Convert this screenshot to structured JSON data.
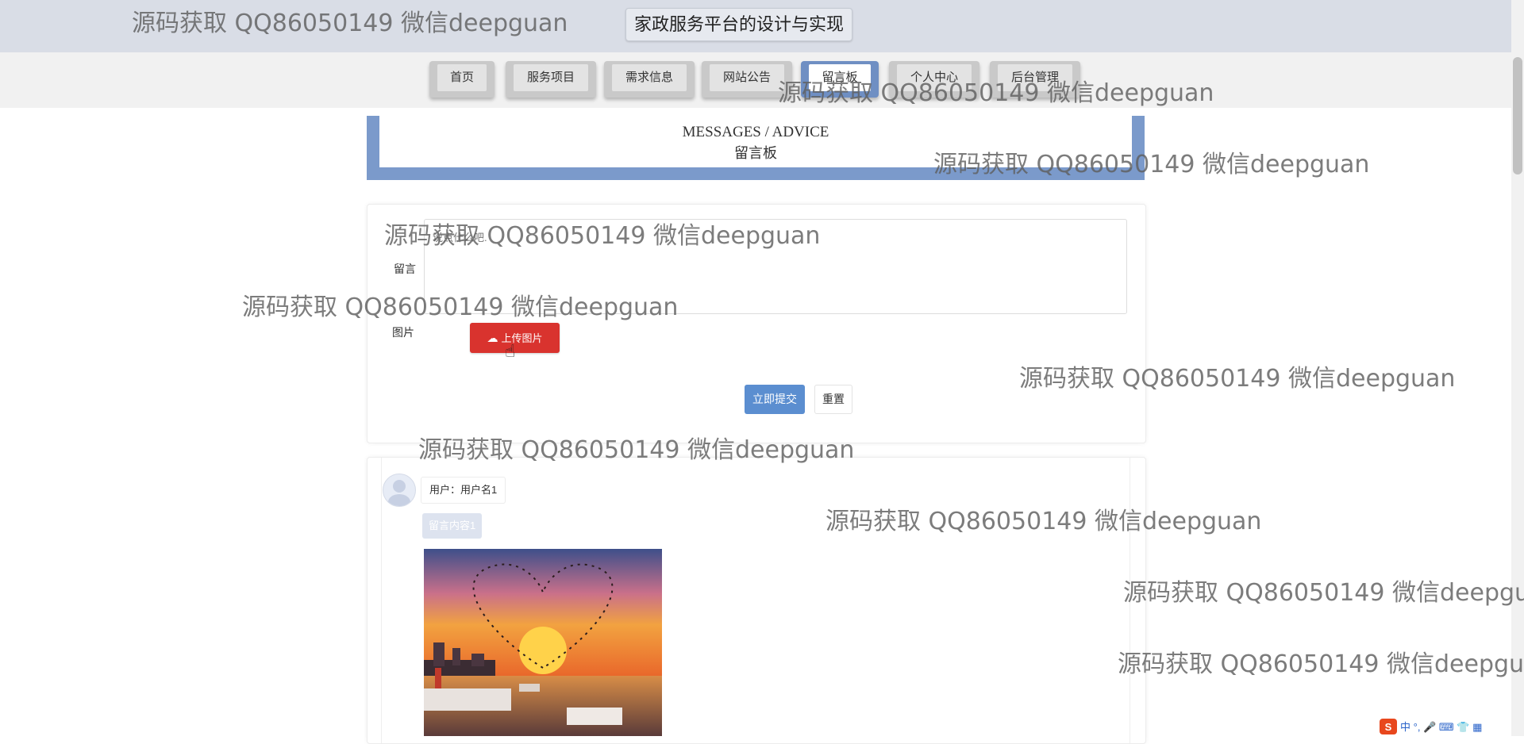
{
  "header": {
    "title": "家政服务平台的设计与实现"
  },
  "nav": {
    "items": [
      {
        "label": "首页"
      },
      {
        "label": "服务项目"
      },
      {
        "label": "需求信息"
      },
      {
        "label": "网站公告"
      },
      {
        "label": "留言板"
      },
      {
        "label": "个人中心"
      },
      {
        "label": "后台管理"
      }
    ],
    "active": "留言板"
  },
  "section": {
    "title_en": "MESSAGES / ADVICE",
    "title_cn": "留言板"
  },
  "form": {
    "message_label": "留言",
    "message_placeholder": "说点什么吧.",
    "image_label": "图片",
    "upload_label": "上传图片",
    "submit_label": "立即提交",
    "reset_label": "重置"
  },
  "comments": [
    {
      "user": "用户：用户名1",
      "content": "留言内容1"
    }
  ],
  "watermark": "源码获取 QQ86050149 微信deepguan",
  "ime": {
    "label": "中"
  },
  "colors": {
    "accent": "#7b9acb",
    "upload": "#d9332e",
    "submit": "#5b8ed0"
  }
}
